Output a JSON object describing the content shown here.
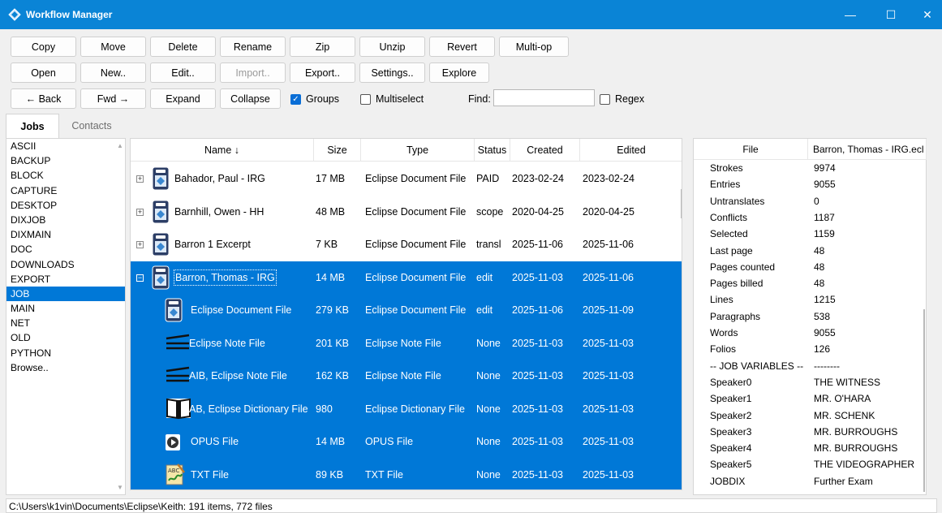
{
  "window": {
    "title": "Workflow Manager",
    "minimize": "—",
    "maximize": "☐",
    "close": "✕"
  },
  "toolbar": {
    "row1": [
      "Copy",
      "Move",
      "Delete",
      "Rename",
      "Zip",
      "Unzip",
      "Revert",
      "Multi-op"
    ],
    "row2": [
      "Open",
      "New..",
      "Edit..",
      "Import..",
      "Export..",
      "Settings..",
      "Explore"
    ],
    "row3": [
      "← Back",
      "Fwd →",
      "Expand",
      "Collapse"
    ],
    "groups_label": "Groups",
    "groups_checked": true,
    "multiselect_label": "Multiselect",
    "multiselect_checked": false,
    "find_label": "Find:",
    "find_value": "",
    "regex_label": "Regex",
    "regex_checked": false
  },
  "tabs": [
    "Jobs",
    "Contacts"
  ],
  "folders": [
    "ASCII",
    "BACKUP",
    "BLOCK",
    "CAPTURE",
    "DESKTOP",
    "DIXJOB",
    "DIXMAIN",
    "DOC",
    "DOWNLOADS",
    "EXPORT",
    "JOB",
    "MAIN",
    "NET",
    "OLD",
    "PYTHON",
    "Browse.."
  ],
  "selected_folder": "JOB",
  "grid": {
    "columns": [
      "Name ↓",
      "Size",
      "Type",
      "Status",
      "Created",
      "Edited"
    ],
    "rows": [
      {
        "expander": "+",
        "icon": "eclipse-document-icon",
        "name": "Bahador, Paul - IRG",
        "size": "17 MB",
        "type": "Eclipse Document File",
        "status": "PAID",
        "created": "2023-02-24",
        "edited": "2023-02-24"
      },
      {
        "expander": "+",
        "icon": "eclipse-document-icon",
        "name": "Barnhill, Owen - HH",
        "size": "48 MB",
        "type": "Eclipse Document File",
        "status": "scope",
        "created": "2020-04-25",
        "edited": "2020-04-25"
      },
      {
        "expander": "+",
        "icon": "eclipse-document-icon",
        "name": "Barron 1 Excerpt",
        "size": "7 KB",
        "type": "Eclipse Document File",
        "status": "transl",
        "created": "2025-11-06",
        "edited": "2025-11-06"
      },
      {
        "expander": "−",
        "icon": "eclipse-document-icon",
        "name": "Barron, Thomas - IRG",
        "size": "14 MB",
        "type": "Eclipse Document File",
        "status": "edit",
        "created": "2025-11-03",
        "edited": "2025-11-06"
      },
      {
        "expander": "",
        "icon": "eclipse-document-icon",
        "name": "Eclipse Document File",
        "size": "279 KB",
        "type": "Eclipse Document File",
        "status": "edit",
        "created": "2025-11-06",
        "edited": "2025-11-09"
      },
      {
        "expander": "",
        "icon": "note-file-icon",
        "name": "Eclipse Note File",
        "size": "201 KB",
        "type": "Eclipse Note File",
        "status": "None",
        "created": "2025-11-03",
        "edited": "2025-11-03"
      },
      {
        "expander": "",
        "icon": "note-file-icon",
        "name": "AIB, Eclipse Note File",
        "size": "162 KB",
        "type": "Eclipse Note File",
        "status": "None",
        "created": "2025-11-03",
        "edited": "2025-11-03"
      },
      {
        "expander": "",
        "icon": "dictionary-book-icon",
        "name": "AB, Eclipse Dictionary File",
        "size": "980",
        "type": "Eclipse Dictionary File",
        "status": "None",
        "created": "2025-11-03",
        "edited": "2025-11-03"
      },
      {
        "expander": "",
        "icon": "opus-audio-icon",
        "name": "OPUS File",
        "size": "14 MB",
        "type": "OPUS File",
        "status": "None",
        "created": "2025-11-03",
        "edited": "2025-11-03"
      },
      {
        "expander": "",
        "icon": "text-file-icon",
        "name": "TXT File",
        "size": "89 KB",
        "type": "TXT File",
        "status": "None",
        "created": "2025-11-03",
        "edited": "2025-11-03"
      }
    ]
  },
  "properties": {
    "header": [
      "File",
      "Barron, Thomas - IRG.ecl"
    ],
    "rows": [
      [
        "Strokes",
        "9974"
      ],
      [
        "Entries",
        "9055"
      ],
      [
        "Untranslates",
        "0"
      ],
      [
        "Conflicts",
        "1187"
      ],
      [
        "Selected",
        "1159"
      ],
      [
        "Last page",
        "48"
      ],
      [
        "Pages counted",
        "48"
      ],
      [
        "Pages billed",
        "48"
      ],
      [
        "Lines",
        "1215"
      ],
      [
        "Paragraphs",
        "538"
      ],
      [
        "Words",
        "9055"
      ],
      [
        "Folios",
        "126"
      ],
      [
        "-- JOB VARIABLES --",
        "--------"
      ],
      [
        "Speaker0",
        "THE WITNESS"
      ],
      [
        "Speaker1",
        "MR. O'HARA"
      ],
      [
        "Speaker2",
        "MR. SCHENK"
      ],
      [
        "Speaker3",
        "MR. BURROUGHS"
      ],
      [
        "Speaker4",
        "MR. BURROUGHS"
      ],
      [
        "Speaker5",
        "THE VIDEOGRAPHER"
      ],
      [
        "JOBDIX",
        "Further Exam"
      ]
    ]
  },
  "status_bar": "C:\\Users\\k1vin\\Documents\\Eclipse\\Keith: 191 items, 772 files",
  "colors": {
    "titlebar": "#0a84d6",
    "selection": "#0078d7"
  }
}
